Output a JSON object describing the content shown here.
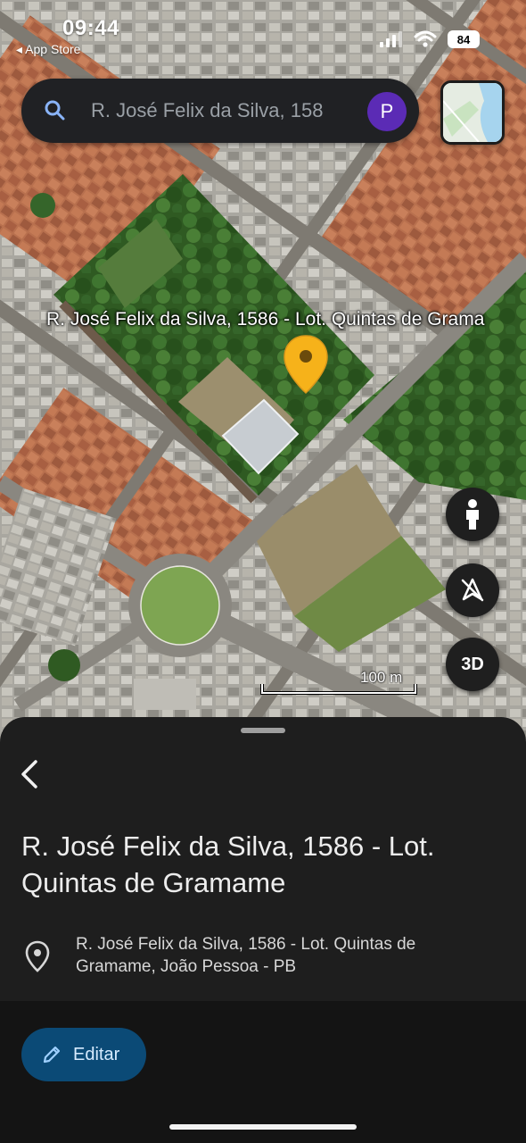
{
  "status_bar": {
    "time": "09:44",
    "back_app": "◂ App Store",
    "battery": "84"
  },
  "search": {
    "value": "R. José Felix da Silva, 158",
    "avatar_letter": "P"
  },
  "map": {
    "place_label": "R. José Felix da Silva, 1586 - Lot. Quintas de Grama",
    "scale_label": "100 m",
    "btn_3d": "3D",
    "pin_color": "#f6b21a"
  },
  "sheet": {
    "title": "R. José Felix da Silva, 1586 - Lot. Quintas de Gramame",
    "address": "R. José Felix da Silva, 1586 - Lot. Quintas de Gramame, João Pessoa - PB",
    "edit_label": "Editar"
  },
  "colors": {
    "accent_button": "#0b4a76",
    "sheet_bg": "#1e1e1e",
    "avatar": "#5b2bb5"
  },
  "icons": [
    "search-icon",
    "avatar",
    "layers-icon",
    "map-pin-icon",
    "pegman-icon",
    "compass-off-icon",
    "back-chevron-icon",
    "location-pin-icon",
    "pencil-icon"
  ]
}
